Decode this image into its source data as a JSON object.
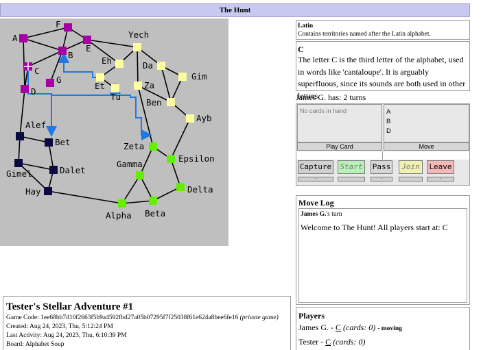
{
  "page": {
    "title": "The Hunt"
  },
  "map": {
    "nodes": [
      {
        "id": "A",
        "label": "A",
        "color": "#a400a4"
      },
      {
        "id": "B",
        "label": "B",
        "color": "#a400a4"
      },
      {
        "id": "C",
        "label": "C",
        "color": "#a400a4"
      },
      {
        "id": "D",
        "label": "D",
        "color": "#a400a4"
      },
      {
        "id": "E",
        "label": "E",
        "color": "#a400a4"
      },
      {
        "id": "F",
        "label": "F",
        "color": "#a400a4"
      },
      {
        "id": "G",
        "label": "G",
        "color": "#a400a4"
      },
      {
        "id": "Yech",
        "label": "Yech",
        "color": "#ffffa0"
      },
      {
        "id": "Eh",
        "label": "Eh",
        "color": "#ffffa0"
      },
      {
        "id": "Da",
        "label": "Da",
        "color": "#ffffa0"
      },
      {
        "id": "Gim",
        "label": "Gim",
        "color": "#ffffa0"
      },
      {
        "id": "Et",
        "label": "Et",
        "color": "#ffffa0"
      },
      {
        "id": "Tu",
        "label": "Tu",
        "color": "#ffffa0"
      },
      {
        "id": "Za",
        "label": "Za",
        "color": "#ffffa0"
      },
      {
        "id": "Ben",
        "label": "Ben",
        "color": "#ffffa0"
      },
      {
        "id": "Ayb",
        "label": "Ayb",
        "color": "#ffffa0"
      },
      {
        "id": "Alef",
        "label": "Alef",
        "color": "#0a0a40"
      },
      {
        "id": "Bet",
        "label": "Bet",
        "color": "#0a0a40"
      },
      {
        "id": "Gimel",
        "label": "Gimel",
        "color": "#0a0a40"
      },
      {
        "id": "Dalet",
        "label": "Dalet",
        "color": "#0a0a40"
      },
      {
        "id": "Hay",
        "label": "Hay",
        "color": "#0a0a40"
      },
      {
        "id": "Zeta",
        "label": "Zeta",
        "color": "#66ee00"
      },
      {
        "id": "Epsilon",
        "label": "Epsilon",
        "color": "#66ee00"
      },
      {
        "id": "Gamma",
        "label": "Gamma",
        "color": "#66ee00"
      },
      {
        "id": "Delta",
        "label": "Delta",
        "color": "#66ee00"
      },
      {
        "id": "Alpha",
        "label": "Alpha",
        "color": "#66ee00"
      },
      {
        "id": "Beta",
        "label": "Beta",
        "color": "#66ee00"
      }
    ],
    "edges": [
      [
        "A",
        "F"
      ],
      [
        "A",
        "B"
      ],
      [
        "A",
        "D"
      ],
      [
        "F",
        "B"
      ],
      [
        "F",
        "E"
      ],
      [
        "B",
        "E"
      ],
      [
        "B",
        "C"
      ],
      [
        "B",
        "G"
      ],
      [
        "C",
        "D"
      ],
      [
        "E",
        "Yech"
      ],
      [
        "E",
        "Eh"
      ],
      [
        "Eh",
        "Yech"
      ],
      [
        "Eh",
        "Et"
      ],
      [
        "Yech",
        "Da"
      ],
      [
        "Yech",
        "Za"
      ],
      [
        "Da",
        "Gim"
      ],
      [
        "Da",
        "Ben"
      ],
      [
        "Gim",
        "Ben"
      ],
      [
        "Za",
        "Ben"
      ],
      [
        "Za",
        "Zeta"
      ],
      [
        "Ben",
        "Ayb"
      ],
      [
        "D",
        "Alef"
      ],
      [
        "Alef",
        "Bet"
      ],
      [
        "Alef",
        "Gimel"
      ],
      [
        "Bet",
        "Dalet"
      ],
      [
        "Gimel",
        "Dalet"
      ],
      [
        "Gimel",
        "Hay"
      ],
      [
        "Dalet",
        "Hay"
      ],
      [
        "Hay",
        "Alpha"
      ],
      [
        "Zeta",
        "Epsilon"
      ],
      [
        "Zeta",
        "Gamma"
      ],
      [
        "Epsilon",
        "Ayb"
      ],
      [
        "Epsilon",
        "Delta"
      ],
      [
        "Gamma",
        "Alpha"
      ],
      [
        "Gamma",
        "Beta"
      ],
      [
        "Alpha",
        "Beta"
      ],
      [
        "Beta",
        "Delta"
      ],
      [
        "Et",
        "Tu"
      ]
    ],
    "route_color": "#1e78e6",
    "selected_node": "C"
  },
  "territory": {
    "group_title": "Latin",
    "group_desc": "Contains territories named after the Latin alphabet.",
    "name": "C",
    "desc": "The letter C is the third letter of the alphabet, used in words like 'cantaloupe'. It is arguably superfluous, since its sounds are both used in other letters."
  },
  "turns": "James G. has: 2 turns",
  "actions": {
    "hand_empty": "No cards in hand",
    "locations": [
      "A",
      "B",
      "D"
    ],
    "play_card": "Play Card",
    "move": "Move",
    "buttons": [
      {
        "label": "Capture",
        "bg": "#d0d0d0"
      },
      {
        "label": "Start",
        "bg": "#b8f0b8"
      },
      {
        "label": "Pass",
        "bg": "#d6d6d6"
      },
      {
        "label": "Join",
        "bg": "#f0f0b0"
      },
      {
        "label": "Leave",
        "bg": "#f4b8b8"
      }
    ],
    "button_bars": [
      "-",
      "",
      "-",
      "",
      "-"
    ]
  },
  "move_log": {
    "title": "Move Log",
    "turn_name": "James G.",
    "turn_suffix": "'s turn",
    "message": "Welcome to The Hunt! All players start at: C"
  },
  "players": {
    "title": "Players",
    "list": [
      {
        "name": "James G. - ",
        "loc": "C",
        "cards": "(cards: 0)",
        "status": "- moving"
      },
      {
        "name": "Tester - ",
        "loc": "C",
        "cards": "(cards: 0)",
        "status": ""
      }
    ]
  },
  "game": {
    "title": "Tester's Stellar Adventure #1",
    "code_label": "Game Code: ",
    "code": "1ee68bb7d10f2663f5b9a4592fbd27a05b07295f7f25038f61e624a8bee6fe16",
    "privacy": "(private game)",
    "created": "Created: Aug 24, 2023, Thu, 5:12:24 PM",
    "last_activity": "Last Activity: Aug 24, 2023, Thu, 6:10:39 PM",
    "board": "Board: Alphabet Soup"
  }
}
